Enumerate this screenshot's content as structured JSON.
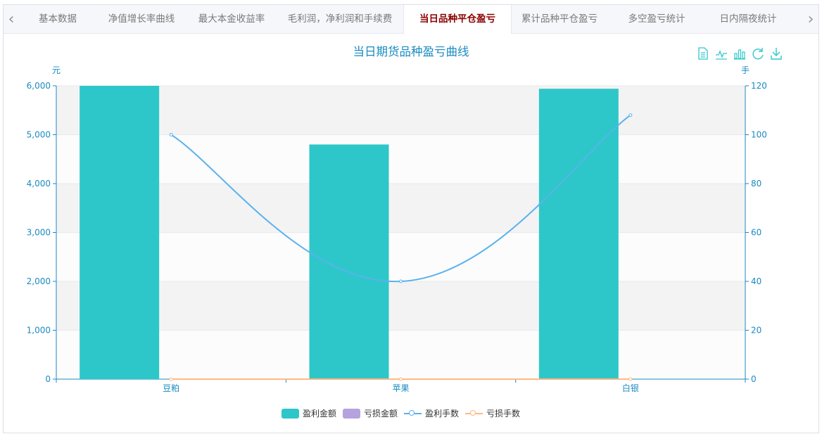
{
  "tabs": [
    {
      "label": "基本数据",
      "active": false
    },
    {
      "label": "净值增长率曲线",
      "active": false
    },
    {
      "label": "最大本金收益率",
      "active": false
    },
    {
      "label": "毛利润，净利润和手续费",
      "active": false
    },
    {
      "label": "当日品种平仓盈亏",
      "active": true
    },
    {
      "label": "累计品种平仓盈亏",
      "active": false
    },
    {
      "label": "多空盈亏统计",
      "active": false
    },
    {
      "label": "日内隔夜统计",
      "active": false
    }
  ],
  "toolbox": [
    "data-view-icon",
    "line-chart-icon",
    "bar-chart-icon",
    "refresh-icon",
    "download-icon"
  ],
  "colors": {
    "profit_amount": "#2ec7c9",
    "loss_amount": "#b6a2de",
    "profit_lots": "#5ab1ef",
    "loss_lots": "#ffb980",
    "axis": "#1a8bc0",
    "active_tab": "#8b0000"
  },
  "chart_data": {
    "type": "bar",
    "title": "当日期货品种盈亏曲线",
    "categories": [
      "豆粕",
      "苹果",
      "白银"
    ],
    "y_left": {
      "label": "元",
      "min": 0,
      "max": 6000,
      "ticks": [
        "0",
        "1,000",
        "2,000",
        "3,000",
        "4,000",
        "5,000",
        "6,000"
      ]
    },
    "y_right": {
      "label": "手",
      "min": 0,
      "max": 120,
      "ticks": [
        "0",
        "20",
        "40",
        "60",
        "80",
        "100",
        "120"
      ]
    },
    "series": [
      {
        "name": "盈利金额",
        "type": "bar",
        "axis": "left",
        "values": [
          6000,
          4800,
          5940
        ]
      },
      {
        "name": "亏损金额",
        "type": "bar",
        "axis": "left",
        "values": [
          0,
          0,
          0
        ]
      },
      {
        "name": "盈利手数",
        "type": "line",
        "axis": "right",
        "values": [
          100,
          40,
          108
        ]
      },
      {
        "name": "亏损手数",
        "type": "line",
        "axis": "right",
        "values": [
          0,
          0,
          0
        ]
      }
    ],
    "grid": true,
    "legend_position": "bottom-center"
  }
}
